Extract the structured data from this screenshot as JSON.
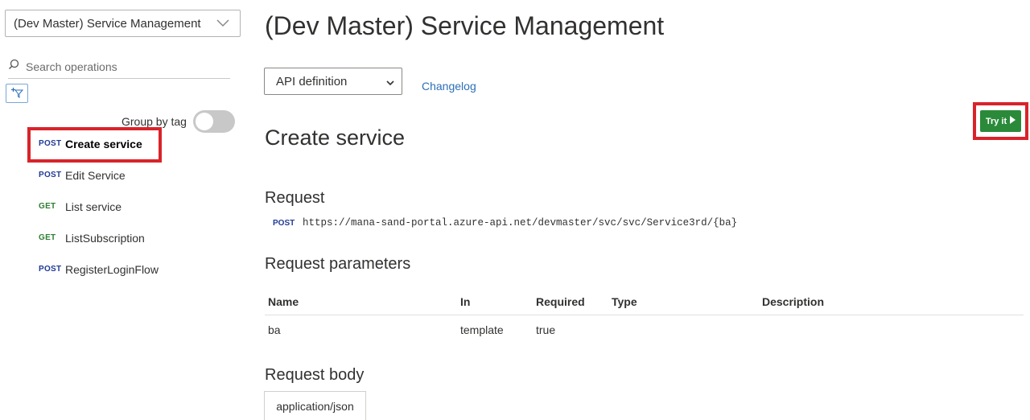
{
  "sidebar": {
    "api_selector": "(Dev Master) Service Management",
    "search_placeholder": "Search operations",
    "group_by_tag_label": "Group by tag",
    "operations": [
      {
        "method": "POST",
        "name": "Create service",
        "active": true
      },
      {
        "method": "POST",
        "name": "Edit Service"
      },
      {
        "method": "GET",
        "name": "List service"
      },
      {
        "method": "GET",
        "name": "ListSubscription"
      },
      {
        "method": "POST",
        "name": "RegisterLoginFlow"
      }
    ]
  },
  "main": {
    "page_title": "(Dev Master) Service Management",
    "definition_select": "API definition",
    "changelog_link": "Changelog",
    "operation_title": "Create service",
    "try_it_label": "Try it",
    "request": {
      "heading": "Request",
      "method": "POST",
      "url": "https://mana-sand-portal.azure-api.net/devmaster/svc/svc/Service3rd/{ba}"
    },
    "parameters": {
      "heading": "Request parameters",
      "columns": [
        "Name",
        "In",
        "Required",
        "Type",
        "Description"
      ],
      "rows": [
        {
          "name": "ba",
          "in": "template",
          "required": "true",
          "type": "",
          "description": ""
        }
      ]
    },
    "request_body": {
      "heading": "Request body",
      "content_type": "application/json"
    }
  },
  "colors": {
    "highlight": "#d9232a",
    "try_it_button": "#2a8a3a",
    "post_method": "#1f3a93",
    "get_method": "#2e7d32",
    "link": "#2c6fb8"
  }
}
